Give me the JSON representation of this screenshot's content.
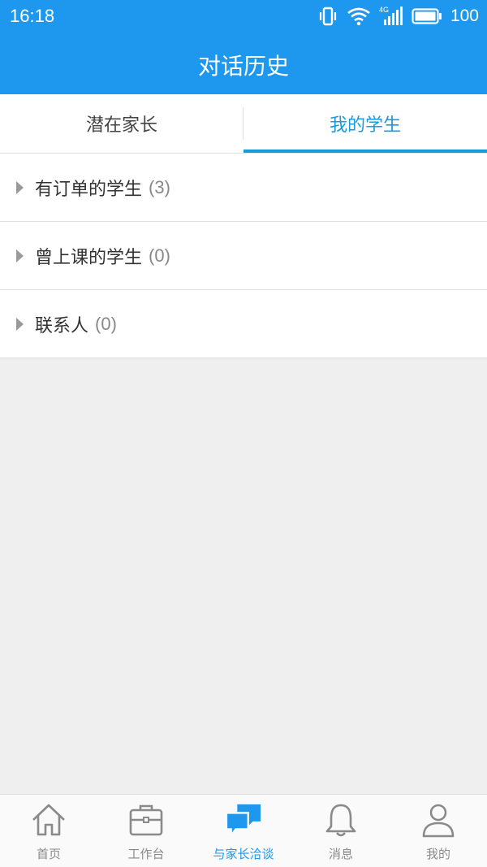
{
  "status": {
    "time": "16:18",
    "network": "4G",
    "battery": "100"
  },
  "header": {
    "title": "对话历史"
  },
  "tabs": [
    {
      "label": "潜在家长",
      "active": false
    },
    {
      "label": "我的学生",
      "active": true
    }
  ],
  "groups": [
    {
      "label": "有订单的学生",
      "count": "(3)"
    },
    {
      "label": "曾上课的学生",
      "count": "(0)"
    },
    {
      "label": "联系人",
      "count": "(0)"
    }
  ],
  "bottom_nav": [
    {
      "label": "首页",
      "icon": "home-icon"
    },
    {
      "label": "工作台",
      "icon": "briefcase-icon"
    },
    {
      "label": "与家长洽谈",
      "icon": "chat-bubbles-icon",
      "active": true
    },
    {
      "label": "消息",
      "icon": "bell-icon"
    },
    {
      "label": "我的",
      "icon": "user-icon"
    }
  ],
  "colors": {
    "primary": "#1e98ee",
    "tab_active": "#1a9ad9",
    "background": "#efefef"
  }
}
